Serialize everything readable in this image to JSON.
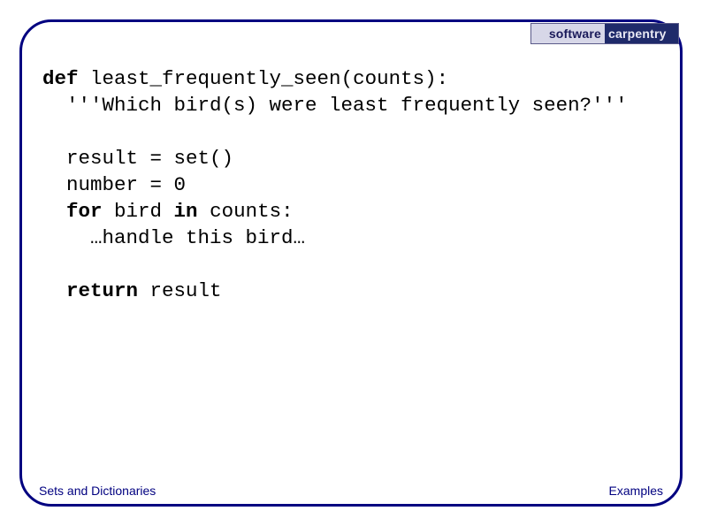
{
  "logo": {
    "left": "software",
    "right": "carpentry"
  },
  "code": {
    "line1_kw": "def",
    "line1_rest": " least_frequently_seen(counts):",
    "line2": "  '''Which bird(s) were least frequently seen?'''",
    "blank": "",
    "line3": "  result = set()",
    "line4": "  number = 0",
    "line5_kw1": "for",
    "line5_mid": " bird ",
    "line5_kw2": "in",
    "line5_rest": " counts:",
    "line5_indent": "  ",
    "line6": "    …handle this bird…",
    "line7_indent": "  ",
    "line7_kw": "return",
    "line7_rest": " result"
  },
  "footer": {
    "left": "Sets and Dictionaries",
    "right": "Examples"
  }
}
